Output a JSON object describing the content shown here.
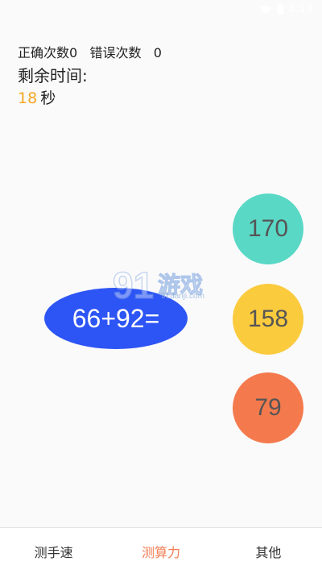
{
  "status_bar": {
    "time": "8:19"
  },
  "stats": {
    "correct_label": "正确次数",
    "correct_count": "0",
    "wrong_label": "错误次数",
    "wrong_count": "0"
  },
  "timer": {
    "label": "剩余时间:",
    "value": "18",
    "unit": "秒"
  },
  "question": "66+92=",
  "watermark": {
    "text": "游戏",
    "subtext": "91danji.com"
  },
  "options": [
    {
      "value": "170",
      "color": "#5ad8c6"
    },
    {
      "value": "158",
      "color": "#fbcb3e"
    },
    {
      "value": "79",
      "color": "#f47a4e"
    }
  ],
  "tabs": [
    {
      "label": "测手速",
      "active": false
    },
    {
      "label": "测算力",
      "active": true
    },
    {
      "label": "其他",
      "active": false
    }
  ],
  "colors": {
    "accent": "#f27f56",
    "timer": "#f5a623",
    "question_bg": "#2d55f5"
  }
}
